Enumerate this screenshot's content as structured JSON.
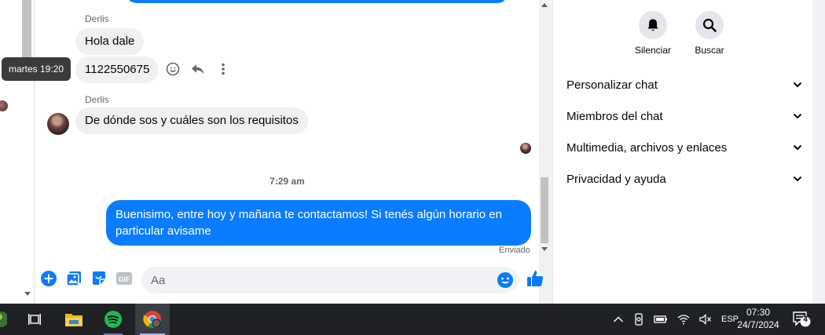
{
  "tooltip": {
    "text": "martes 19:20"
  },
  "messages": {
    "sender_1": "Derlis",
    "msg_1": "Hola dale",
    "msg_2": "1122550675",
    "sender_2": "Derlis",
    "msg_3": "De dónde sos y cuáles son los requisitos",
    "time_separator": "7:29 am",
    "outgoing_1": "Buenisimo, entre hoy y mañana te contactamos! Si tenés algún horario en particular avisame",
    "status": "Enviado"
  },
  "composer": {
    "placeholder": "Aa"
  },
  "right_panel": {
    "actions": [
      {
        "label": "Silenciar",
        "icon": "bell-icon"
      },
      {
        "label": "Buscar",
        "icon": "search-icon"
      }
    ],
    "sections": [
      {
        "label": "Personalizar chat"
      },
      {
        "label": "Miembros del chat"
      },
      {
        "label": "Multimedia, archivos y enlaces"
      },
      {
        "label": "Privacidad y ayuda"
      }
    ]
  },
  "taskbar": {
    "language": "ESP",
    "time": "07:30",
    "date": "24/7/2024",
    "notification_count": "4"
  },
  "colors": {
    "accent": "#0a7cff",
    "bubble_in": "#f0f0f0",
    "taskbar": "#1f2125"
  }
}
